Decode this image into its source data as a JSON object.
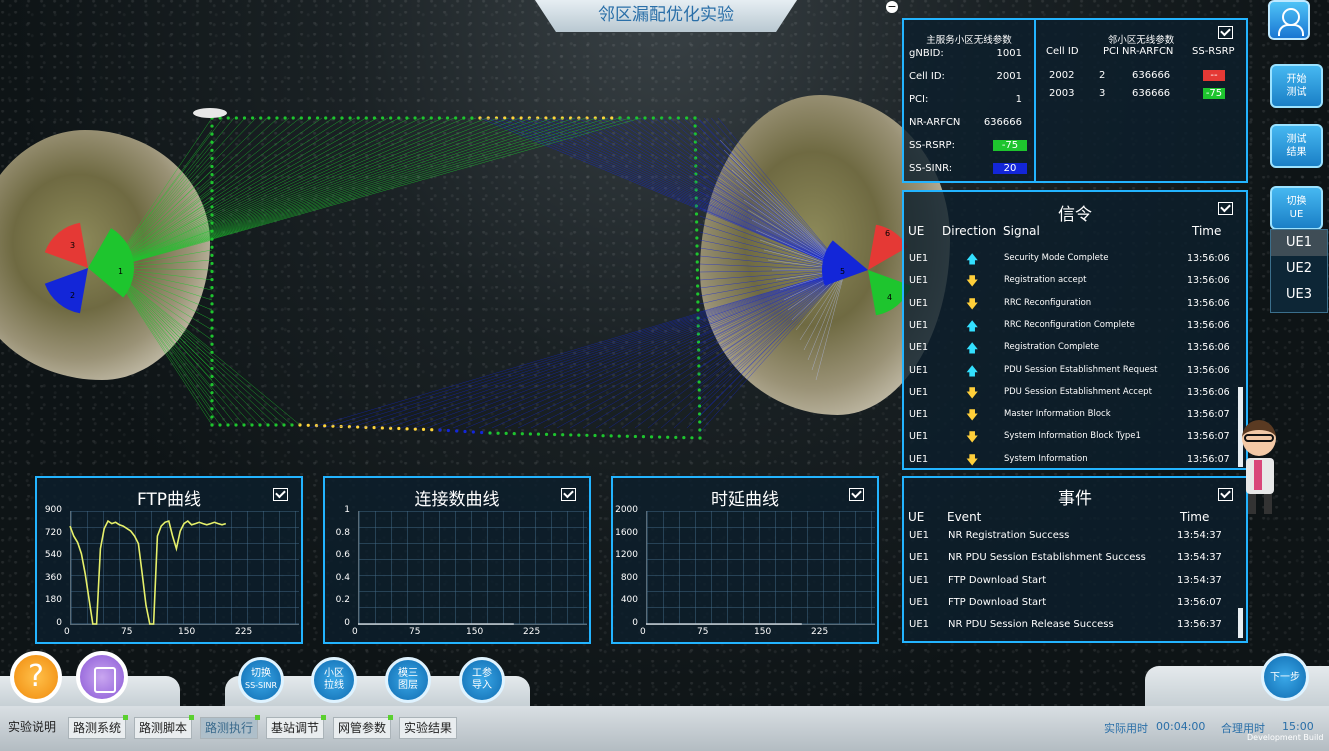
{
  "title": "邻区漏配优化实验",
  "serving": {
    "header": "主服务小区无线参数",
    "rows": [
      {
        "label": "gNBID:",
        "value": "1001"
      },
      {
        "label": "Cell ID:",
        "value": "2001"
      },
      {
        "label": "PCI:",
        "value": "1"
      },
      {
        "label": "NR-ARFCN",
        "value": "636666"
      },
      {
        "label": "SS-RSRP:",
        "value": "-75"
      },
      {
        "label": "SS-SINR:",
        "value": "20"
      }
    ]
  },
  "neighbor": {
    "header": "邻小区无线参数",
    "cols": [
      "Cell ID",
      "PCI",
      "NR-ARFCN",
      "SS-RSRP"
    ],
    "rows": [
      {
        "cell": "2002",
        "pci": "2",
        "arfcn": "636666",
        "rsrp": "--"
      },
      {
        "cell": "2003",
        "pci": "3",
        "arfcn": "636666",
        "rsrp": "-75"
      }
    ]
  },
  "signaling": {
    "header": "信令",
    "cols": [
      "UE",
      "Direction",
      "Signal",
      "Time"
    ],
    "rows": [
      {
        "ue": "UE1",
        "dir": "up",
        "signal": "Security Mode Complete",
        "time": "13:56:06"
      },
      {
        "ue": "UE1",
        "dir": "down",
        "signal": "Registration accept",
        "time": "13:56:06"
      },
      {
        "ue": "UE1",
        "dir": "down",
        "signal": "RRC Reconfiguration",
        "time": "13:56:06"
      },
      {
        "ue": "UE1",
        "dir": "up",
        "signal": "RRC Reconfiguration Complete",
        "time": "13:56:06"
      },
      {
        "ue": "UE1",
        "dir": "up",
        "signal": "Registration Complete",
        "time": "13:56:06"
      },
      {
        "ue": "UE1",
        "dir": "up",
        "signal": "PDU Session Establishment Request",
        "time": "13:56:06"
      },
      {
        "ue": "UE1",
        "dir": "down",
        "signal": "PDU Session Establishment Accept",
        "time": "13:56:06"
      },
      {
        "ue": "UE1",
        "dir": "down",
        "signal": "Master Information Block",
        "time": "13:56:07"
      },
      {
        "ue": "UE1",
        "dir": "down",
        "signal": "System Information Block Type1",
        "time": "13:56:07"
      },
      {
        "ue": "UE1",
        "dir": "down",
        "signal": "System Information",
        "time": "13:56:07"
      }
    ]
  },
  "events": {
    "header": "事件",
    "cols": [
      "UE",
      "Event",
      "Time"
    ],
    "rows": [
      {
        "ue": "UE1",
        "event": "NR Registration Success",
        "time": "13:54:37"
      },
      {
        "ue": "UE1",
        "event": "NR PDU Session Establishment Success",
        "time": "13:54:37"
      },
      {
        "ue": "UE1",
        "event": "FTP Download Start",
        "time": "13:54:37"
      },
      {
        "ue": "UE1",
        "event": "FTP Download Start",
        "time": "13:56:07"
      },
      {
        "ue": "UE1",
        "event": "NR PDU Session Release Success",
        "time": "13:56:37"
      }
    ]
  },
  "side": {
    "start": [
      "开始",
      "测试"
    ],
    "result": [
      "测试",
      "结果"
    ],
    "switch": [
      "切换",
      "UE"
    ],
    "ues": [
      "UE1",
      "UE2",
      "UE3"
    ]
  },
  "bottom_buttons": [
    [
      "切换",
      "SS-SINR"
    ],
    [
      "小区",
      "拉线"
    ],
    [
      "模三",
      "图层"
    ],
    [
      "工参",
      "导入"
    ]
  ],
  "next": "下一步",
  "tabs": [
    "实验说明",
    "路测系统",
    "路测脚本",
    "路测执行",
    "基站调节",
    "网管参数",
    "实验结果"
  ],
  "status": {
    "actual_label": "实际用时",
    "actual": "00:04:00",
    "reasonable_label": "合理用时",
    "reasonable": "15:00",
    "build": "Development Build"
  },
  "sectors_left": [
    "3",
    "1",
    "2"
  ],
  "sectors_right": [
    "6",
    "5",
    "4"
  ],
  "colors": {
    "accent": "#23b4ff",
    "green": "#1ec52e",
    "red": "#e53935",
    "blue": "#1326d8"
  },
  "chart_data": [
    {
      "type": "line",
      "title": "FTP曲线",
      "ylim": [
        0,
        900
      ],
      "yticks": [
        0,
        180,
        360,
        540,
        720,
        900
      ],
      "xticks": [
        0,
        75,
        150,
        225
      ],
      "xlim": [
        0,
        300
      ],
      "series": [
        {
          "color": "#e6f06a",
          "x": [
            0,
            5,
            10,
            15,
            20,
            25,
            30,
            35,
            40,
            45,
            50,
            55,
            60,
            65,
            70,
            75,
            80,
            85,
            90,
            95,
            100,
            105,
            110,
            115,
            120,
            125,
            130,
            135,
            140,
            145,
            150,
            155,
            160,
            165,
            170,
            175,
            180,
            185,
            190,
            195,
            200,
            205
          ],
          "y": [
            780,
            700,
            650,
            560,
            400,
            200,
            0,
            0,
            600,
            760,
            820,
            800,
            810,
            790,
            780,
            760,
            740,
            700,
            640,
            400,
            150,
            0,
            0,
            700,
            780,
            810,
            820,
            700,
            600,
            740,
            800,
            820,
            790,
            800,
            810,
            800,
            790,
            800,
            810,
            800,
            790,
            800
          ]
        }
      ]
    },
    {
      "type": "line",
      "title": "连接数曲线",
      "ylim": [
        0,
        1
      ],
      "yticks": [
        0,
        0.2,
        0.4,
        0.6,
        0.8,
        1
      ],
      "xticks": [
        0,
        75,
        150,
        225
      ],
      "xlim": [
        0,
        300
      ],
      "series": [
        {
          "color": "#ffffff",
          "x": [
            0,
            205
          ],
          "y": [
            0,
            0
          ]
        }
      ]
    },
    {
      "type": "line",
      "title": "时延曲线",
      "ylim": [
        0,
        2000
      ],
      "yticks": [
        0,
        400,
        800,
        1200,
        1600,
        2000
      ],
      "xticks": [
        0,
        75,
        150,
        225
      ],
      "xlim": [
        0,
        300
      ],
      "series": [
        {
          "color": "#ffffff",
          "x": [
            0,
            205
          ],
          "y": [
            0,
            0
          ]
        }
      ]
    }
  ]
}
